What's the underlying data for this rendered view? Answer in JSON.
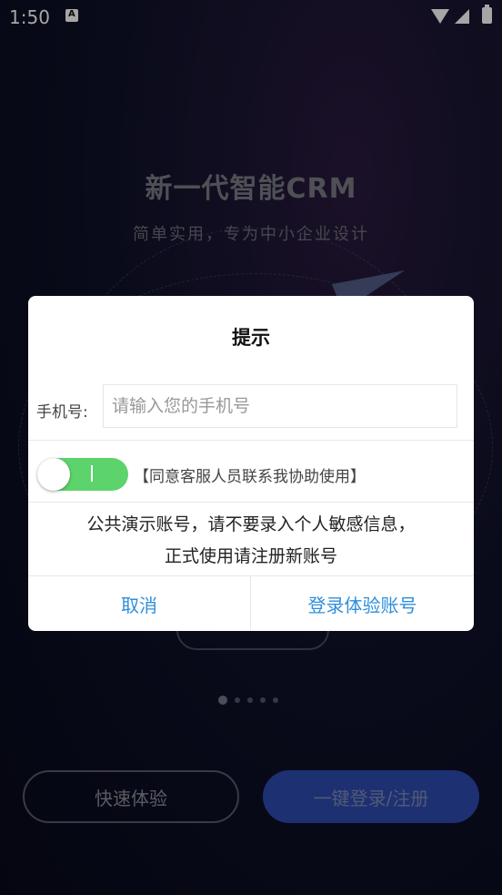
{
  "status_bar": {
    "time": "1:50"
  },
  "background": {
    "title": "新一代智能CRM",
    "subtitle": "简单实用，专为中小企业设计",
    "carousel_dots": 5,
    "active_dot": 0,
    "quick_button": "快速体验",
    "login_button": "一键登录/注册"
  },
  "dialog": {
    "title": "提示",
    "phone_label": "手机号:",
    "phone_placeholder": "请输入您的手机号",
    "phone_value": "",
    "toggle_on": true,
    "agree_text": "【同意客服人员联系我协助使用】",
    "notice_line1": "公共演示账号，请不要录入个人敏感信息，",
    "notice_line2": "正式使用请注册新账号",
    "cancel_label": "取消",
    "confirm_label": "登录体验账号"
  },
  "colors": {
    "accent": "#2f8fdc",
    "toggle_on": "#5dd36b",
    "login_button": "#2d4bb0"
  }
}
